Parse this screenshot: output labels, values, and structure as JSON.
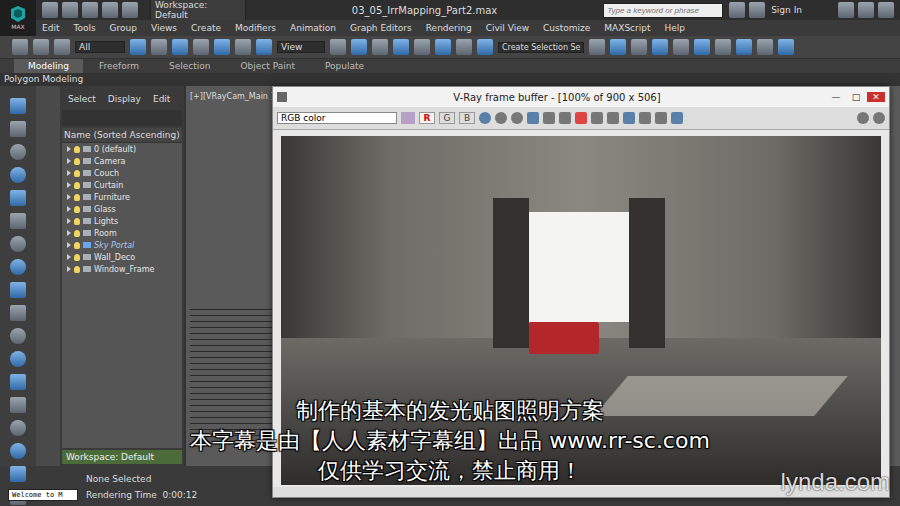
{
  "title_bar": {
    "logo": "MAX",
    "workspace": "Workspace: Default",
    "file": "03_05_IrrMapping_Part2.max",
    "search_placeholder": "Type a keyword or phrase",
    "sign_in": "Sign In"
  },
  "menu": [
    "Edit",
    "Tools",
    "Group",
    "Views",
    "Create",
    "Modifiers",
    "Animation",
    "Graph Editors",
    "Rendering",
    "Civil View",
    "Customize",
    "MAXScript",
    "Help"
  ],
  "toolbar": {
    "filter": "All",
    "coord": "View",
    "selection_set": "Create Selection Se"
  },
  "ribbon": {
    "tabs": [
      {
        "label": "Modeling",
        "selected": true
      },
      {
        "label": "Freeform",
        "selected": false
      },
      {
        "label": "Selection",
        "selected": false
      },
      {
        "label": "Object Paint",
        "selected": false
      },
      {
        "label": "Populate",
        "selected": false
      }
    ],
    "panel": "Polygon Modeling"
  },
  "explorer": {
    "menu": [
      "Select",
      "Display",
      "Edit"
    ],
    "column": "Name (Sorted Ascending)",
    "layers": [
      {
        "name": "0 (default)",
        "frozen": false
      },
      {
        "name": "Camera",
        "frozen": false
      },
      {
        "name": "Couch",
        "frozen": false
      },
      {
        "name": "Curtain",
        "frozen": false
      },
      {
        "name": "Furniture",
        "frozen": false
      },
      {
        "name": "Glass",
        "frozen": false
      },
      {
        "name": "Lights",
        "frozen": false
      },
      {
        "name": "Room",
        "frozen": false
      },
      {
        "name": "Sky Portal",
        "frozen": true
      },
      {
        "name": "Wall_Deco",
        "frozen": false
      },
      {
        "name": "Window_Frame",
        "frozen": false
      }
    ],
    "workspace": "Workspace: Default"
  },
  "viewport": {
    "label": "[+][VRayCam_Main ][W"
  },
  "vfb": {
    "title": "V-Ray frame buffer - [100% of 900 x 506]",
    "controls": [
      "—",
      "□",
      "✕"
    ],
    "channel": "RGB color",
    "buttons": [
      {
        "label": "R",
        "selected": true
      },
      {
        "label": "G",
        "selected": false
      },
      {
        "label": "B",
        "selected": false
      }
    ]
  },
  "status": {
    "listener": "Welcome to M",
    "selection": "None Selected",
    "render_time": "Rendering Time  0:00:12"
  },
  "subtitles": [
    "制作的基本的发光贴图照明方案",
    "本字幕是由【人人素材字幕组】出品 www.rr-sc.com",
    "仅供学习交流，禁止商用！"
  ],
  "watermark": "lynda.com"
}
